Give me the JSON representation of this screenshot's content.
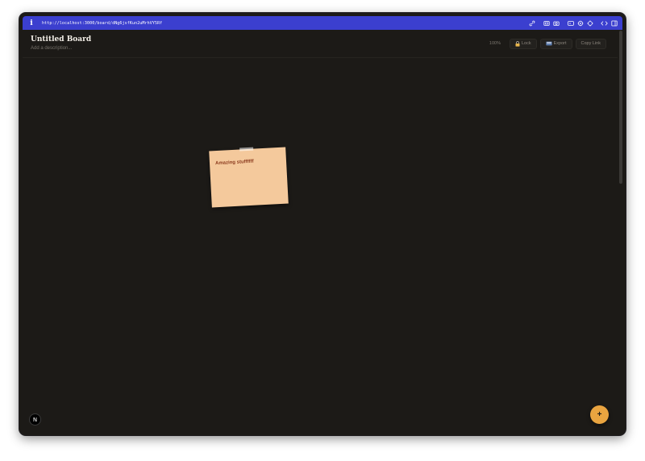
{
  "browser": {
    "url": "http://localhost:3000/board/dNg6jsfKun2uMrhVY5Rf",
    "info_glyph": "i"
  },
  "board": {
    "title": "Untitled Board",
    "description_placeholder": "Add a description..."
  },
  "toolbar": {
    "zoom": "100%",
    "lock_label": "Lock",
    "export_label": "Export",
    "copy_link_label": "Copy Link"
  },
  "notes": [
    {
      "text": "Amazing stuffffff",
      "color": "#f4c99c"
    }
  ],
  "fab": {
    "label": "+"
  },
  "next_badge": {
    "label": "N"
  },
  "colors": {
    "urlbar": "#3b3fcf",
    "canvas": "#1c1a17",
    "accent": "#e9a440"
  }
}
